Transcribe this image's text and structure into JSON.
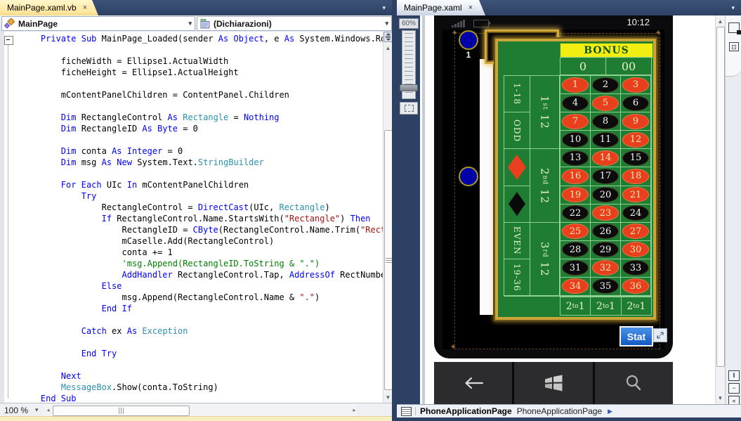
{
  "left_pane": {
    "tab": {
      "label": "MainPage.xaml.vb",
      "close_glyph": "×"
    },
    "tab_overflow_glyph": "▾",
    "nav": {
      "object_dropdown": {
        "label": "MainPage",
        "arrow": "▾"
      },
      "declarations_dropdown": {
        "label": "(Dichiarazioni)",
        "arrow": "▾"
      }
    },
    "editor": {
      "outline_glyph": "-",
      "token_colors": {
        "k": "#0000ff",
        "t": "#2b91af",
        "s": "#a31515",
        "c": "#008000",
        "p": "#000000"
      },
      "code_lines": [
        [
          [
            "p",
            "    "
          ],
          [
            "k",
            "Private"
          ],
          [
            "p",
            " "
          ],
          [
            "k",
            "Sub"
          ],
          [
            "p",
            " MainPage_Loaded(sender "
          ],
          [
            "k",
            "As"
          ],
          [
            "p",
            " "
          ],
          [
            "k",
            "Object"
          ],
          [
            "p",
            ", e "
          ],
          [
            "k",
            "As"
          ],
          [
            "p",
            " System.Windows.Ro"
          ]
        ],
        [],
        [
          [
            "p",
            "        ficheWidth = Ellipse1.ActualWidth"
          ]
        ],
        [
          [
            "p",
            "        ficheHeight = Ellipse1.ActualHeight"
          ]
        ],
        [],
        [
          [
            "p",
            "        mContentPanelChildren = ContentPanel.Children"
          ]
        ],
        [],
        [
          [
            "p",
            "        "
          ],
          [
            "k",
            "Dim"
          ],
          [
            "p",
            " RectangleControl "
          ],
          [
            "k",
            "As"
          ],
          [
            "p",
            " "
          ],
          [
            "t",
            "Rectangle"
          ],
          [
            "p",
            " = "
          ],
          [
            "k",
            "Nothing"
          ]
        ],
        [
          [
            "p",
            "        "
          ],
          [
            "k",
            "Dim"
          ],
          [
            "p",
            " RectangleID "
          ],
          [
            "k",
            "As"
          ],
          [
            "p",
            " "
          ],
          [
            "k",
            "Byte"
          ],
          [
            "p",
            " = 0"
          ]
        ],
        [],
        [
          [
            "p",
            "        "
          ],
          [
            "k",
            "Dim"
          ],
          [
            "p",
            " conta "
          ],
          [
            "k",
            "As"
          ],
          [
            "p",
            " "
          ],
          [
            "k",
            "Integer"
          ],
          [
            "p",
            " = 0"
          ]
        ],
        [
          [
            "p",
            "        "
          ],
          [
            "k",
            "Dim"
          ],
          [
            "p",
            " msg "
          ],
          [
            "k",
            "As"
          ],
          [
            "p",
            " "
          ],
          [
            "k",
            "New"
          ],
          [
            "p",
            " System.Text."
          ],
          [
            "t",
            "StringBuilder"
          ]
        ],
        [],
        [
          [
            "p",
            "        "
          ],
          [
            "k",
            "For"
          ],
          [
            "p",
            " "
          ],
          [
            "k",
            "Each"
          ],
          [
            "p",
            " UIc "
          ],
          [
            "k",
            "In"
          ],
          [
            "p",
            " mContentPanelChildren"
          ]
        ],
        [
          [
            "p",
            "            "
          ],
          [
            "k",
            "Try"
          ]
        ],
        [
          [
            "p",
            "                RectangleControl = "
          ],
          [
            "k",
            "DirectCast"
          ],
          [
            "p",
            "(UIc, "
          ],
          [
            "t",
            "Rectangle"
          ],
          [
            "p",
            ")"
          ]
        ],
        [
          [
            "p",
            "                "
          ],
          [
            "k",
            "If"
          ],
          [
            "p",
            " RectangleControl.Name.StartsWith("
          ],
          [
            "s",
            "\"Rectangle\""
          ],
          [
            "p",
            ") "
          ],
          [
            "k",
            "Then"
          ]
        ],
        [
          [
            "p",
            "                    RectangleID = "
          ],
          [
            "k",
            "CByte"
          ],
          [
            "p",
            "(RectangleControl.Name.Trim("
          ],
          [
            "s",
            "\"Rect"
          ]
        ],
        [
          [
            "p",
            "                    mCaselle.Add(RectangleControl)"
          ]
        ],
        [
          [
            "p",
            "                    conta += 1"
          ]
        ],
        [
          [
            "c",
            "                    'msg.Append(RectangleID.ToString & \".\")"
          ]
        ],
        [
          [
            "p",
            "                    "
          ],
          [
            "k",
            "AddHandler"
          ],
          [
            "p",
            " RectangleControl.Tap, "
          ],
          [
            "k",
            "AddressOf"
          ],
          [
            "p",
            " RectNumbe"
          ]
        ],
        [
          [
            "p",
            "                "
          ],
          [
            "k",
            "Else"
          ]
        ],
        [
          [
            "p",
            "                    msg.Append(RectangleControl.Name & "
          ],
          [
            "s",
            "\".\""
          ],
          [
            "p",
            ")"
          ]
        ],
        [
          [
            "p",
            "                "
          ],
          [
            "k",
            "End If"
          ]
        ],
        [],
        [
          [
            "p",
            "            "
          ],
          [
            "k",
            "Catch"
          ],
          [
            "p",
            " ex "
          ],
          [
            "k",
            "As"
          ],
          [
            "p",
            " "
          ],
          [
            "t",
            "Exception"
          ]
        ],
        [],
        [
          [
            "p",
            "            "
          ],
          [
            "k",
            "End Try"
          ]
        ],
        [],
        [
          [
            "p",
            "        "
          ],
          [
            "k",
            "Next"
          ]
        ],
        [
          [
            "p",
            "        "
          ],
          [
            "t",
            "MessageBox"
          ],
          [
            "p",
            ".Show(conta.ToString)"
          ]
        ],
        [
          [
            "p",
            "    "
          ],
          [
            "k",
            "End Sub"
          ]
        ]
      ]
    },
    "status_bar": {
      "zoom_level": "100 %",
      "arrow": "▾",
      "left_arrow": "◂",
      "right_arrow": "▸"
    }
  },
  "right_pane": {
    "tab": {
      "label": "MainPage.xaml",
      "close_glyph": "×"
    },
    "tab_overflow_glyph": "▾",
    "designer": {
      "zoom_control": {
        "value": "60%"
      },
      "phone": {
        "status_clock": "10:12",
        "chips": [
          {
            "label": "1"
          },
          {
            "label": ""
          }
        ],
        "stat_button": "Stat"
      },
      "roulette": {
        "banner": "BONUS",
        "zeros": [
          "0",
          "00"
        ],
        "outer_labels": [
          "1-18",
          "ODD",
          "EVEN",
          "19-36"
        ],
        "dozens": [
          [
            "1",
            "st",
            " 12"
          ],
          [
            "2",
            "nd",
            " 12"
          ],
          [
            "3",
            "rd",
            " 12"
          ]
        ],
        "bottom_row": [
          [
            "2",
            "to",
            "1"
          ],
          [
            "2",
            "to",
            "1"
          ],
          [
            "2",
            "to",
            "1"
          ]
        ],
        "grid_rows": [
          [
            {
              "n": "1",
              "c": "red"
            },
            {
              "n": "2",
              "c": "black"
            },
            {
              "n": "3",
              "c": "red"
            }
          ],
          [
            {
              "n": "4",
              "c": "black"
            },
            {
              "n": "5",
              "c": "red"
            },
            {
              "n": "6",
              "c": "black"
            }
          ],
          [
            {
              "n": "7",
              "c": "red"
            },
            {
              "n": "8",
              "c": "black"
            },
            {
              "n": "9",
              "c": "red"
            }
          ],
          [
            {
              "n": "10",
              "c": "black"
            },
            {
              "n": "11",
              "c": "black"
            },
            {
              "n": "12",
              "c": "red"
            }
          ],
          [
            {
              "n": "13",
              "c": "black"
            },
            {
              "n": "14",
              "c": "red"
            },
            {
              "n": "15",
              "c": "black"
            }
          ],
          [
            {
              "n": "16",
              "c": "red"
            },
            {
              "n": "17",
              "c": "black"
            },
            {
              "n": "18",
              "c": "red"
            }
          ],
          [
            {
              "n": "19",
              "c": "red"
            },
            {
              "n": "20",
              "c": "black"
            },
            {
              "n": "21",
              "c": "red"
            }
          ],
          [
            {
              "n": "22",
              "c": "black"
            },
            {
              "n": "23",
              "c": "red"
            },
            {
              "n": "24",
              "c": "black"
            }
          ],
          [
            {
              "n": "25",
              "c": "red"
            },
            {
              "n": "26",
              "c": "black"
            },
            {
              "n": "27",
              "c": "red"
            }
          ],
          [
            {
              "n": "28",
              "c": "black"
            },
            {
              "n": "29",
              "c": "black"
            },
            {
              "n": "30",
              "c": "red"
            }
          ],
          [
            {
              "n": "31",
              "c": "black"
            },
            {
              "n": "32",
              "c": "red"
            },
            {
              "n": "33",
              "c": "black"
            }
          ],
          [
            {
              "n": "34",
              "c": "red"
            },
            {
              "n": "35",
              "c": "black"
            },
            {
              "n": "36",
              "c": "red"
            }
          ]
        ],
        "colors": {
          "table_green": "#1f7d33",
          "red": "#e8401f",
          "black": "#0c0c0c",
          "gold": "#caa53a",
          "banner_yellow": "#f2ee12"
        }
      }
    },
    "breadcrumb": {
      "primary": "PhoneApplicationPage",
      "secondary": "PhoneApplicationPage",
      "arrow": "▶"
    }
  }
}
